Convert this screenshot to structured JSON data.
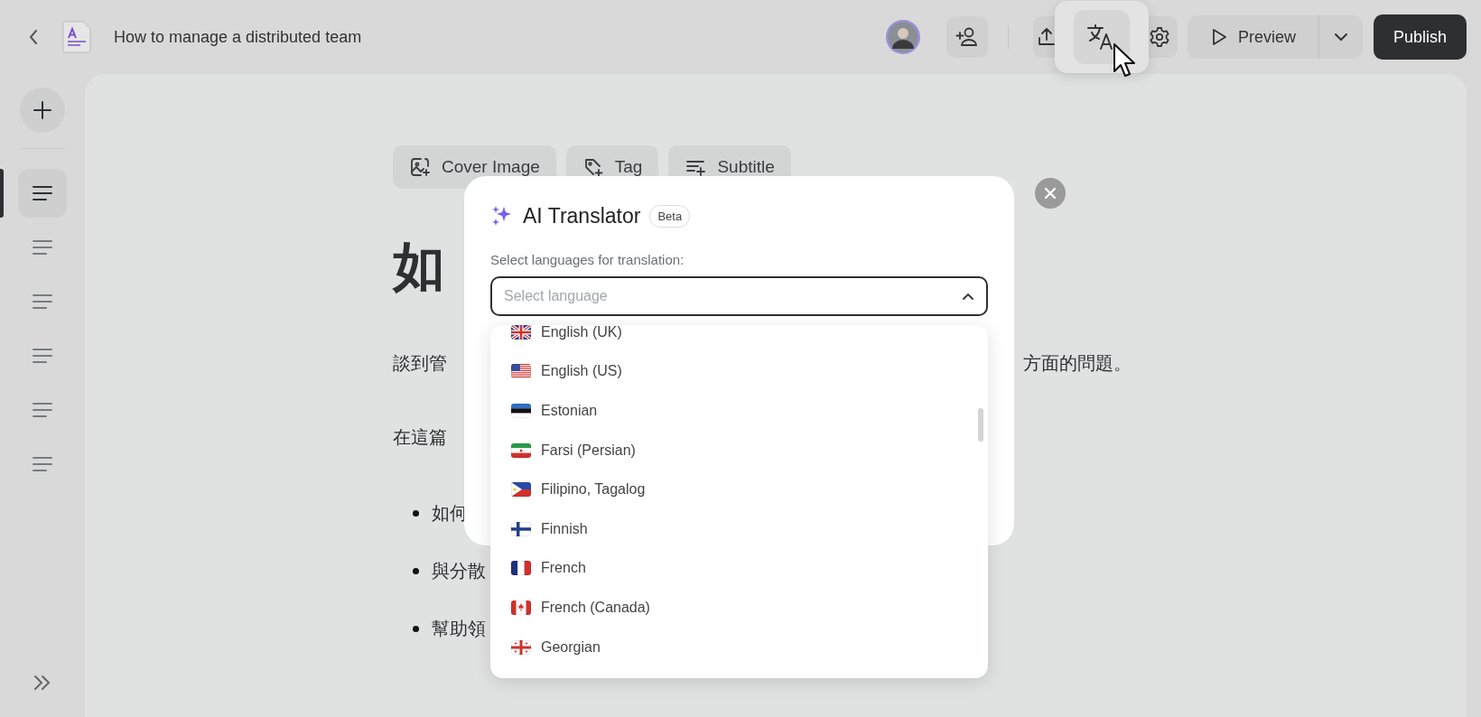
{
  "top_bar": {
    "document_title": "How to manage a distributed team",
    "preview_label": "Preview",
    "publish_label": "Publish",
    "translate_hovered": true
  },
  "sidebar": {
    "items": [
      {
        "selected": true
      },
      {
        "selected": false
      },
      {
        "selected": false
      },
      {
        "selected": false
      },
      {
        "selected": false
      },
      {
        "selected": false
      }
    ]
  },
  "editor_toolbar": [
    {
      "kind": "image",
      "label": "Cover Image"
    },
    {
      "kind": "tag",
      "label": "Tag"
    },
    {
      "kind": "subtitle",
      "label": "Subtitle"
    }
  ],
  "article": {
    "heading": "如",
    "paragraphs": [
      [
        "談到管",
        "方面的問題。"
      ],
      [
        "在這篇"
      ]
    ],
    "bullets": [
      "如何",
      "與分散",
      "幫助領"
    ]
  },
  "translator_dialog": {
    "title": "AI Translator",
    "badge": "Beta",
    "label": "Select languages for translation:",
    "select": {
      "placeholder": "Select language",
      "expanded": true
    },
    "options": [
      {
        "kind": "uk",
        "label": "English (UK)"
      },
      {
        "kind": "us",
        "label": "English (US)"
      },
      {
        "kind": "ee",
        "label": "Estonian"
      },
      {
        "kind": "ir",
        "label": "Farsi (Persian)"
      },
      {
        "kind": "ph",
        "label": "Filipino, Tagalog"
      },
      {
        "kind": "fi",
        "label": "Finnish"
      },
      {
        "kind": "fr",
        "label": "French"
      },
      {
        "kind": "ca",
        "label": "French (Canada)"
      },
      {
        "kind": "ge",
        "label": "Georgian"
      }
    ]
  }
}
